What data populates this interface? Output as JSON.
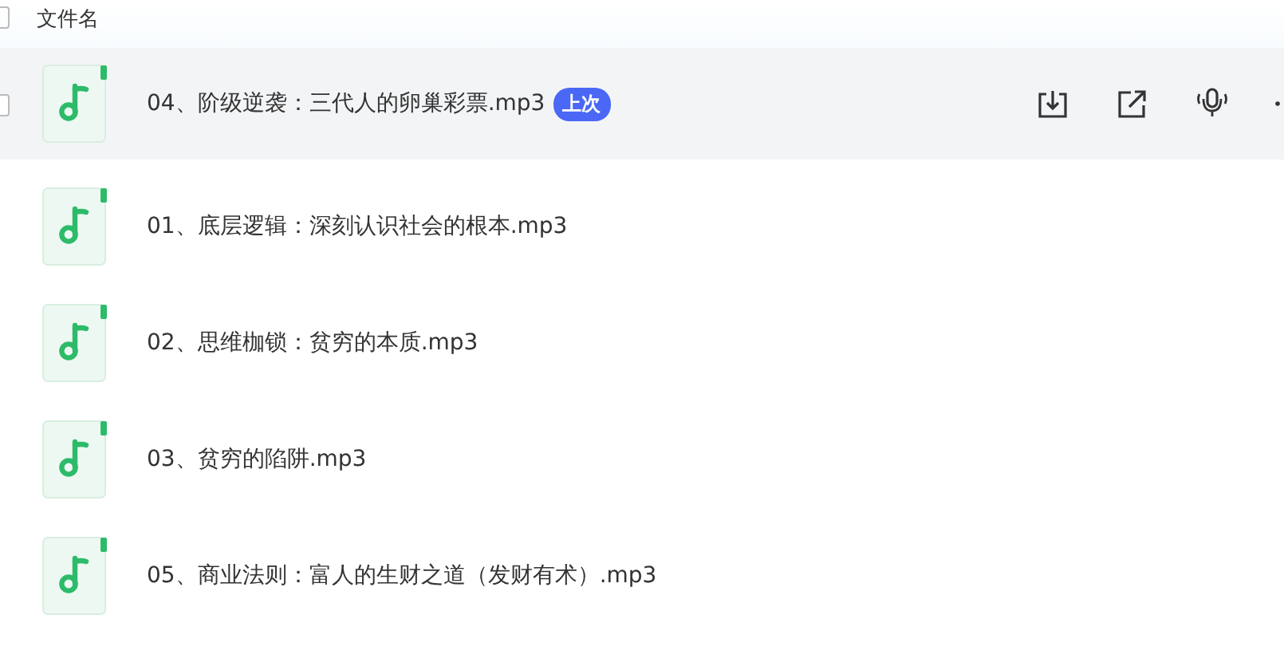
{
  "header": {
    "column_label": "文件名",
    "checked": false
  },
  "files": [
    {
      "name": "04、阶级逆袭：三代人的卵巢彩票.mp3",
      "badge": "上次",
      "selected": true,
      "checked": false
    },
    {
      "name": "01、底层逻辑：深刻认识社会的根本.mp3",
      "selected": false
    },
    {
      "name": "02、思维枷锁：贫穷的本质.mp3",
      "selected": false
    },
    {
      "name": "03、贫穷的陷阱.mp3",
      "selected": false
    },
    {
      "name": "05、商业法则：富人的生财之道（发财有术）.mp3",
      "selected": false
    }
  ]
}
